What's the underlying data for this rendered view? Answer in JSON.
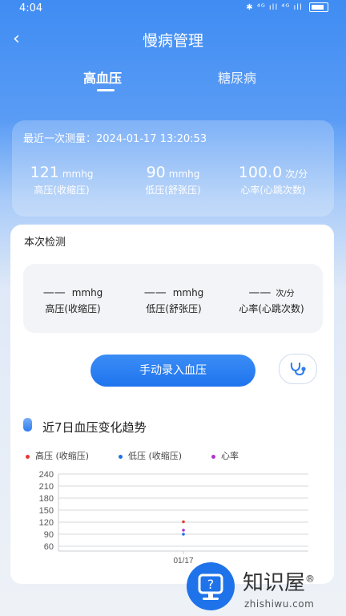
{
  "status": {
    "time": "4:04",
    "signal": "⁴ᴳ ıll ⁴ᴳ ıll"
  },
  "nav": {
    "title": "慢病管理"
  },
  "tabs": [
    {
      "label": "高血压"
    },
    {
      "label": "糖尿病"
    }
  ],
  "last": {
    "caption": "最近一次测量：",
    "datetime": "2024-01-17 13:20:53",
    "stats": [
      {
        "value": "121",
        "unit": "mmhg",
        "label": "高压(收缩压)"
      },
      {
        "value": "90",
        "unit": "mmhg",
        "label": "低压(舒张压)"
      },
      {
        "value": "100.0",
        "unit": "次/分",
        "label": "心率(心跳次数)"
      }
    ]
  },
  "current": {
    "title": "本次检测",
    "cells": [
      {
        "value": "——",
        "unit": "mmhg",
        "label": "高压(收缩压)"
      },
      {
        "value": "——",
        "unit": "mmhg",
        "label": "低压(舒张压)"
      },
      {
        "value": "——",
        "unit": "次/分",
        "label": "心率(心跳次数)"
      }
    ]
  },
  "actions": {
    "manual": "手动录入血压"
  },
  "trend": {
    "title": "近7日血压变化趋势",
    "legend": [
      {
        "label": "高压 (收缩压)",
        "color": "#e53935"
      },
      {
        "label": "低压 (收缩压)",
        "color": "#1e6fe8"
      },
      {
        "label": "心率",
        "color": "#b233c9"
      }
    ]
  },
  "chart_data": {
    "type": "scatter",
    "categories": [
      "01/17"
    ],
    "yticks": [
      240,
      210,
      180,
      150,
      120,
      90,
      60
    ],
    "ylim": [
      60,
      240
    ],
    "series": [
      {
        "name": "高压 (收缩压)",
        "values": [
          121
        ],
        "color": "#e53935"
      },
      {
        "name": "低压 (收缩压)",
        "values": [
          90
        ],
        "color": "#1e6fe8"
      },
      {
        "name": "心率",
        "values": [
          100
        ],
        "color": "#b233c9"
      }
    ]
  },
  "watermark": {
    "text": "知识屋",
    "url": "zhishiwu.com",
    "mark": "®"
  }
}
